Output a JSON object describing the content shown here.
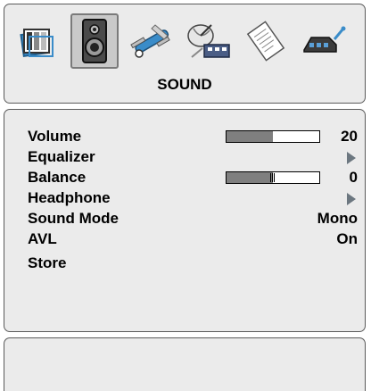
{
  "menu": {
    "title": "SOUND",
    "tabs": [
      {
        "name": "picture",
        "icon": "picture-icon",
        "selected": false
      },
      {
        "name": "sound",
        "icon": "speaker-icon",
        "selected": true
      },
      {
        "name": "features",
        "icon": "tools-icon",
        "selected": false
      },
      {
        "name": "install",
        "icon": "satellite-dish-icon",
        "selected": false
      },
      {
        "name": "source",
        "icon": "document-icon",
        "selected": false
      },
      {
        "name": "connection",
        "icon": "connector-icon",
        "selected": false
      }
    ]
  },
  "sound": {
    "volume": {
      "label": "Volume",
      "value": "20",
      "level": 0.5
    },
    "equalizer": {
      "label": "Equalizer"
    },
    "balance": {
      "label": "Balance",
      "value": "0",
      "position": 0.5
    },
    "headphone": {
      "label": "Headphone"
    },
    "sound_mode": {
      "label": "Sound Mode",
      "value": "Mono"
    },
    "avl": {
      "label": "AVL",
      "value": "On"
    },
    "store": {
      "label": "Store"
    }
  },
  "colors": {
    "panel": "#ebebeb",
    "border": "#5a5a5a",
    "bar_fill": "#7f7f7f",
    "selected_tile": "#c9c9c9",
    "arrow": "#6c7780"
  }
}
